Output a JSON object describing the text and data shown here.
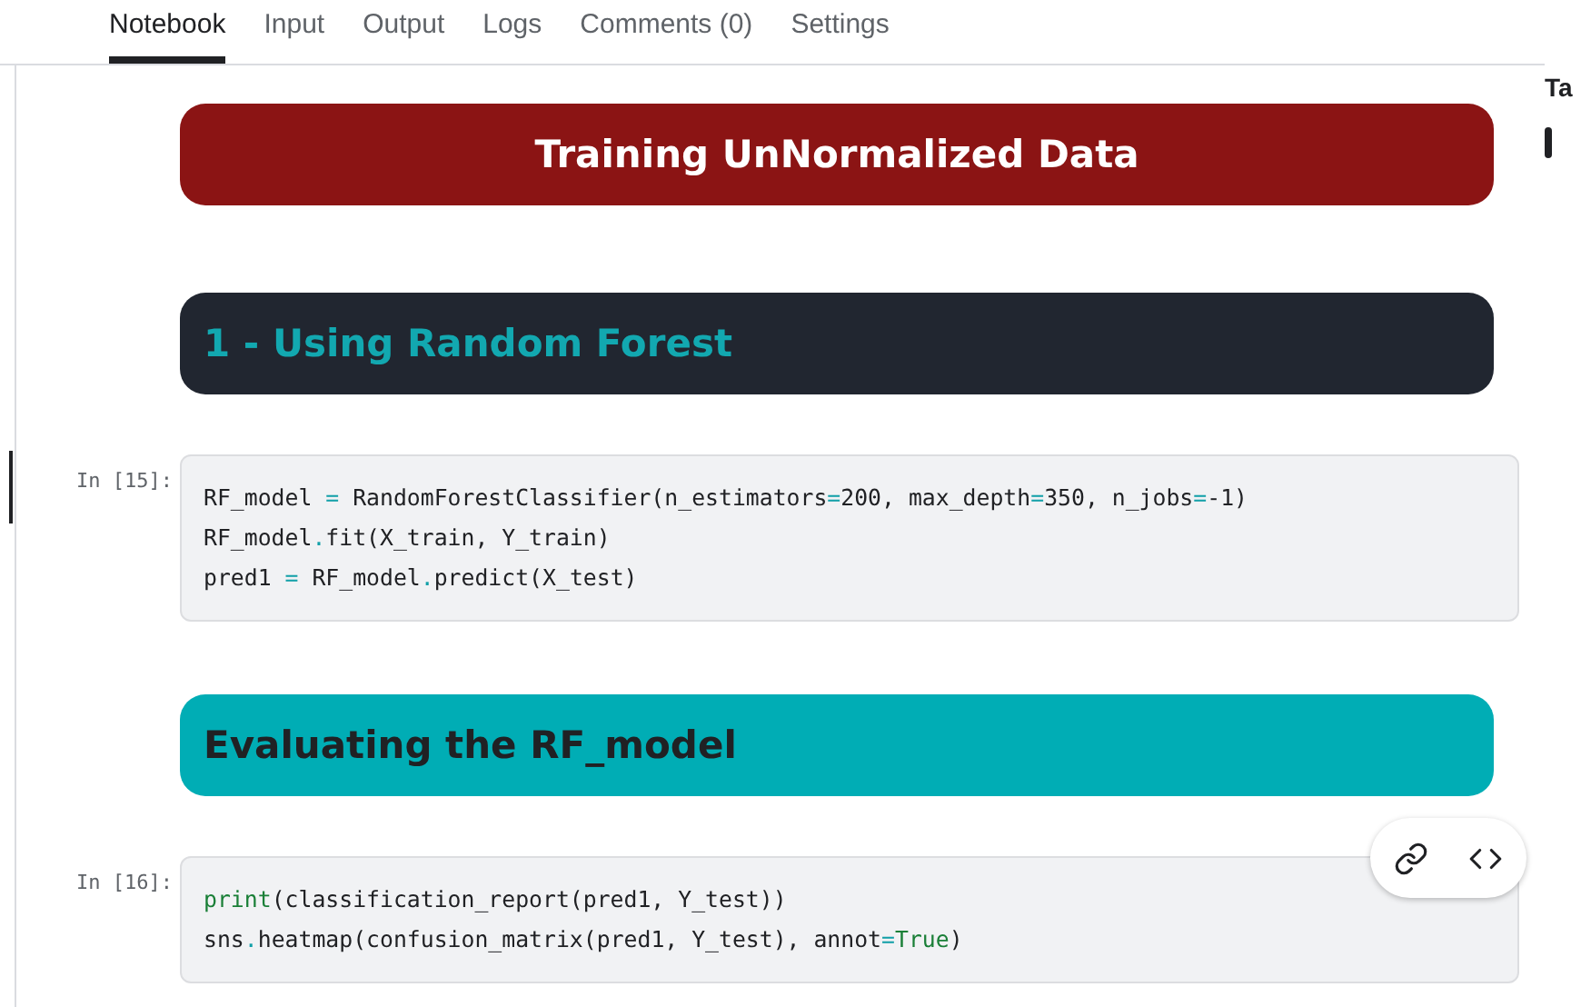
{
  "tabs": [
    {
      "label": "Notebook",
      "selected": true
    },
    {
      "label": "Input",
      "selected": false
    },
    {
      "label": "Output",
      "selected": false
    },
    {
      "label": "Logs",
      "selected": false
    },
    {
      "label": "Comments (0)",
      "selected": false
    },
    {
      "label": "Settings",
      "selected": false
    }
  ],
  "side_panel": {
    "title": "Ta"
  },
  "cells": [
    {
      "kind": "title",
      "text": "Training UnNormalized Data"
    },
    {
      "kind": "section",
      "text": "1 - Using Random Forest"
    },
    {
      "kind": "code",
      "prompt": "In [15]:",
      "selected": true,
      "hovered": false,
      "lines": [
        [
          {
            "text": "RF_model ",
            "kind": "plain"
          },
          {
            "text": "=",
            "kind": "operator"
          },
          {
            "text": " RandomForestClassifier(n_estimators",
            "kind": "plain"
          },
          {
            "text": "=",
            "kind": "operator"
          },
          {
            "text": "200",
            "kind": "number"
          },
          {
            "text": ", max_depth",
            "kind": "plain"
          },
          {
            "text": "=",
            "kind": "operator"
          },
          {
            "text": "350",
            "kind": "number"
          },
          {
            "text": ", n_jobs",
            "kind": "plain"
          },
          {
            "text": "=",
            "kind": "operator"
          },
          {
            "text": "-1",
            "kind": "number"
          },
          {
            "text": ")",
            "kind": "plain"
          }
        ],
        [
          {
            "text": "RF_model",
            "kind": "plain"
          },
          {
            "text": ".",
            "kind": "operator"
          },
          {
            "text": "fit(X_train, Y_train)",
            "kind": "plain"
          }
        ],
        [
          {
            "text": "pred1 ",
            "kind": "plain"
          },
          {
            "text": "=",
            "kind": "operator"
          },
          {
            "text": " RF_model",
            "kind": "plain"
          },
          {
            "text": ".",
            "kind": "operator"
          },
          {
            "text": "predict(X_test)",
            "kind": "plain"
          }
        ]
      ]
    },
    {
      "kind": "subsection",
      "text": "Evaluating the RF_model"
    },
    {
      "kind": "code",
      "prompt": "In [16]:",
      "selected": false,
      "hovered": true,
      "lines": [
        [
          {
            "text": "print",
            "kind": "builtin"
          },
          {
            "text": "(classification_report(pred1, Y_test))",
            "kind": "plain"
          }
        ],
        [
          {
            "text": "sns",
            "kind": "plain"
          },
          {
            "text": ".",
            "kind": "operator"
          },
          {
            "text": "heatmap(confusion_matrix(pred1, Y_test), annot",
            "kind": "plain"
          },
          {
            "text": "=",
            "kind": "operator"
          },
          {
            "text": "True",
            "kind": "builtin"
          },
          {
            "text": ")",
            "kind": "plain"
          }
        ]
      ]
    }
  ]
}
